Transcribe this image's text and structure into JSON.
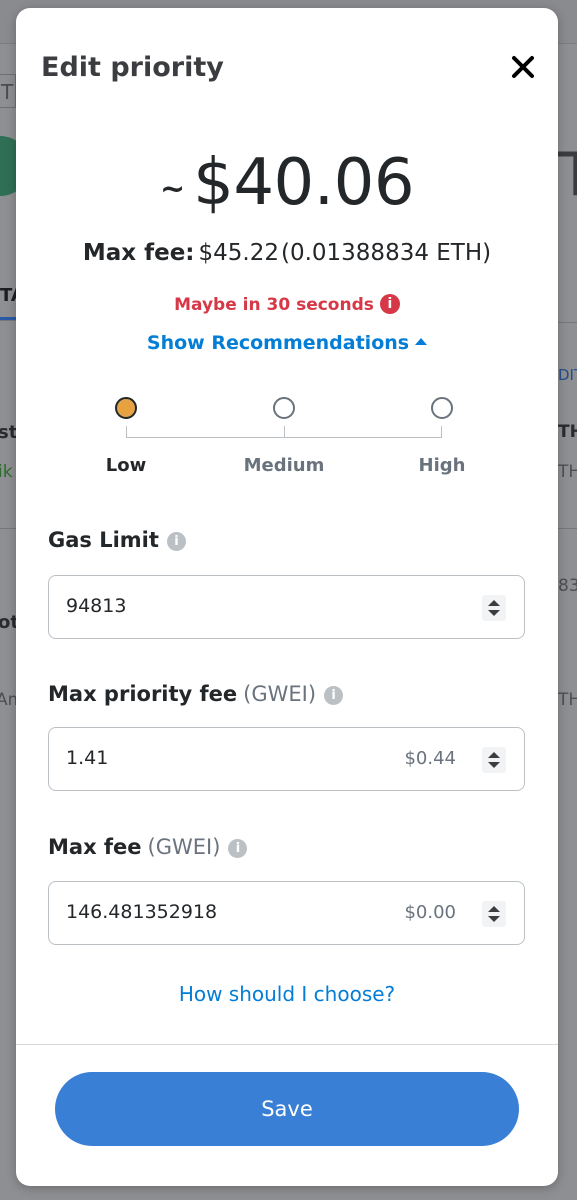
{
  "background_page": {
    "left_tab_fragment": "T",
    "left_active_tab_fragment": "TA",
    "left_text_fragments": [
      "st",
      "ik",
      "ot",
      "Am"
    ],
    "right_big_fragment": "T",
    "right_text_fragments": [
      "DIT",
      "TH",
      "TH",
      "83",
      "TH"
    ]
  },
  "modal": {
    "title": "Edit priority",
    "close_icon": "close-icon",
    "estimate": {
      "tilde": "~",
      "amount": "$40.06"
    },
    "max_fee": {
      "label": "Max fee:",
      "usd": "$45.22",
      "eth": "(0.01388834 ETH)"
    },
    "timing": {
      "text": "Maybe in 30 seconds",
      "color": "#d73847"
    },
    "show_recommendations": "Show Recommendations",
    "priority_levels": {
      "selected": "Low",
      "options": [
        "Low",
        "Medium",
        "High"
      ]
    },
    "gas_limit": {
      "label": "Gas Limit",
      "value": "94813"
    },
    "max_priority_fee": {
      "label": "Max priority fee",
      "unit": "(GWEI)",
      "value": "1.41",
      "fiat": "$0.44"
    },
    "max_fee_field": {
      "label": "Max fee",
      "unit": "(GWEI)",
      "value": "146.481352918",
      "fiat": "$0.00"
    },
    "help_link": "How should I choose?",
    "save_label": "Save",
    "accent_color": "#037dd6"
  }
}
